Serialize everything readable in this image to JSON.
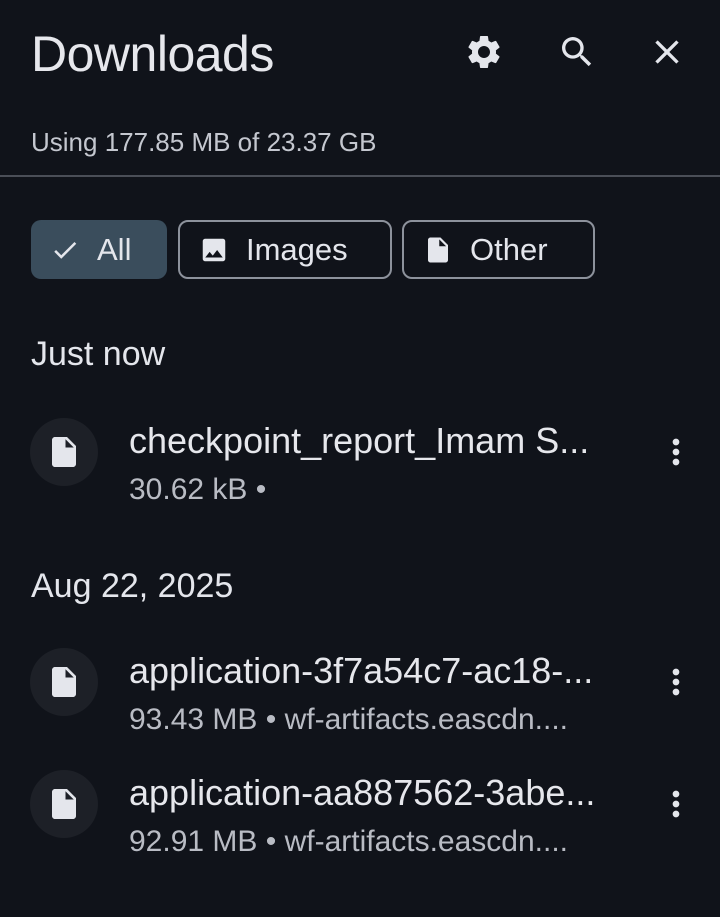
{
  "header": {
    "title": "Downloads",
    "settings_icon": "gear-icon",
    "search_icon": "search-icon",
    "close_icon": "close-icon"
  },
  "usage_text": "Using 177.85 MB of 23.37 GB",
  "filters": [
    {
      "label": "All",
      "icon": "check-icon",
      "selected": true
    },
    {
      "label": "Images",
      "icon": "image-icon",
      "selected": false
    },
    {
      "label": "Other",
      "icon": "file-icon",
      "selected": false
    }
  ],
  "sections": [
    {
      "label": "Just now",
      "items": [
        {
          "name": "checkpoint_report_Imam S...",
          "meta": "30.62 kB •",
          "icon": "file-icon"
        }
      ]
    },
    {
      "label": "Aug 22, 2025",
      "items": [
        {
          "name": "application-3f7a54c7-ac18-...",
          "meta": "93.43 MB • wf-artifacts.eascdn....",
          "icon": "file-icon"
        },
        {
          "name": "application-aa887562-3abe...",
          "meta": "92.91 MB • wf-artifacts.eascdn....",
          "icon": "file-icon"
        }
      ]
    }
  ],
  "colors": {
    "background": "#10131a",
    "selected_chip": "#3a4d5c",
    "chip_border": "#8d929c",
    "icon_circle": "#1d2027"
  }
}
